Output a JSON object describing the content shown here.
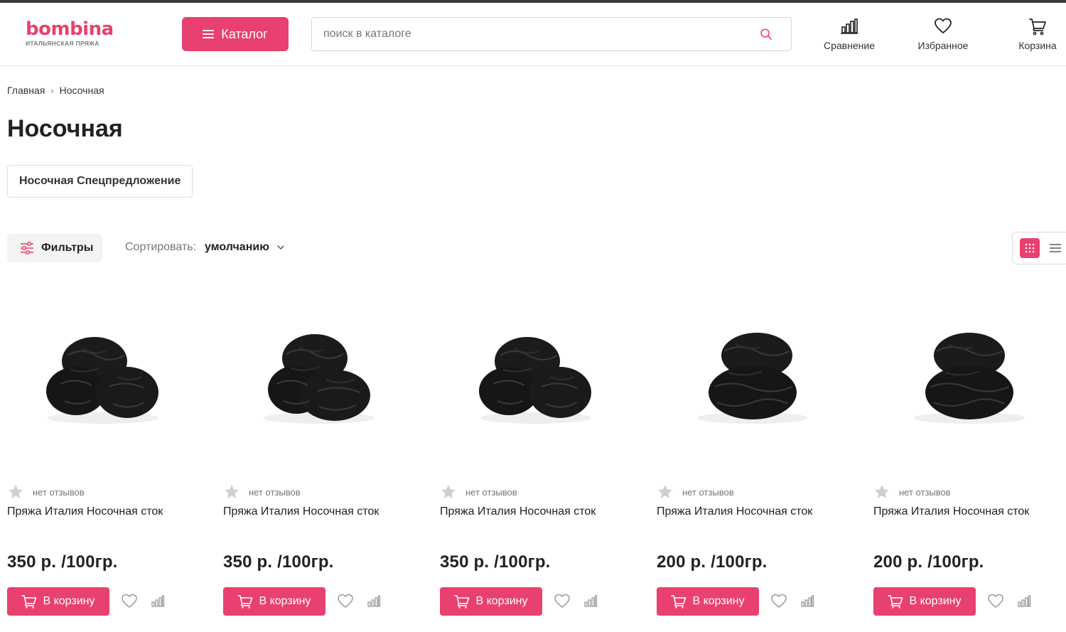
{
  "header": {
    "logo_brand": "bombina",
    "logo_tagline": "ИТАЛЬЯНСКАЯ ПРЯЖА",
    "catalog_label": "Каталог",
    "search_placeholder": "поиск в каталоге",
    "nav": {
      "compare": "Сравнение",
      "favorites": "Избранное",
      "cart": "Корзина"
    }
  },
  "breadcrumb": {
    "home": "Главная",
    "current": "Носочная"
  },
  "page_title": "Носочная",
  "subcategory_chip": "Носочная Спецпредложение",
  "toolbar": {
    "filters_label": "Фильтры",
    "sort_label": "Сортировать:",
    "sort_value": "умолчанию"
  },
  "products": [
    {
      "rating_text": "нет отзывов",
      "name": "Пряжа Италия Носочная сток",
      "price": "350 р. /100гр.",
      "cart_label": "В корзину"
    },
    {
      "rating_text": "нет отзывов",
      "name": "Пряжа Италия Носочная сток",
      "price": "350 р. /100гр.",
      "cart_label": "В корзину"
    },
    {
      "rating_text": "нет отзывов",
      "name": "Пряжа Италия Носочная сток",
      "price": "350 р. /100гр.",
      "cart_label": "В корзину"
    },
    {
      "rating_text": "нет отзывов",
      "name": "Пряжа Италия Носочная сток",
      "price": "200 р. /100гр.",
      "cart_label": "В корзину"
    },
    {
      "rating_text": "нет отзывов",
      "name": "Пряжа Италия Носочная сток",
      "price": "200 р. /100гр.",
      "cart_label": "В корзину"
    }
  ],
  "icons": [
    "menu-icon",
    "search-icon",
    "compare-icon",
    "heart-icon",
    "cart-icon",
    "filter-icon",
    "chevron-down-icon",
    "grid-view-icon",
    "list-view-icon",
    "star-icon"
  ],
  "colors": {
    "accent": "#e8416f",
    "text": "#222222",
    "muted": "#777777"
  }
}
